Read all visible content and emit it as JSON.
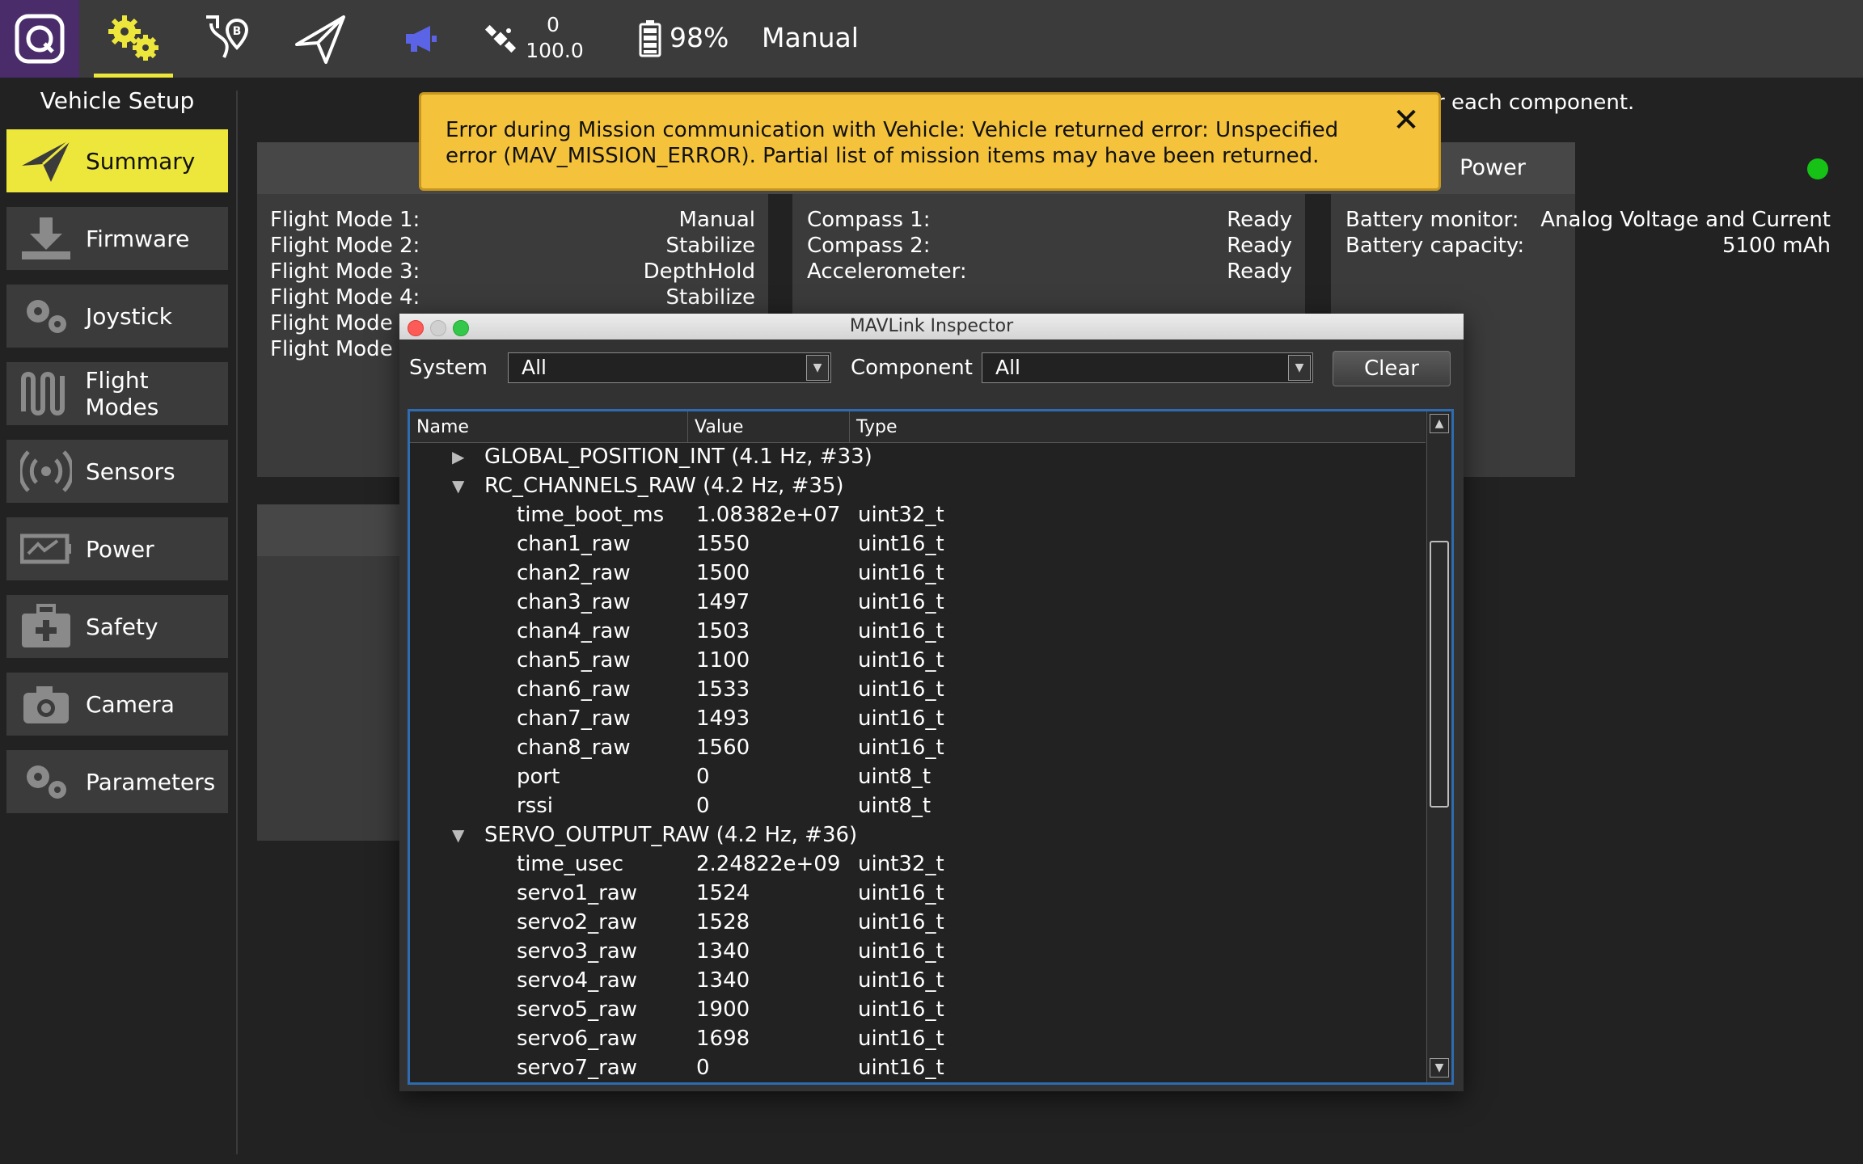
{
  "toolbar": {
    "satellite_count": "0",
    "satellite_hdop": "100.0",
    "battery_percent": "98%",
    "flight_mode": "Manual"
  },
  "sidebar": {
    "title": "Vehicle Setup",
    "items": [
      {
        "label": "Summary",
        "icon": "paper-plane-icon",
        "active": true
      },
      {
        "label": "Firmware",
        "icon": "download-icon"
      },
      {
        "label": "Joystick",
        "icon": "gears-icon"
      },
      {
        "label": "Flight Modes",
        "icon": "wave-icon"
      },
      {
        "label": "Sensors",
        "icon": "radio-waves-icon"
      },
      {
        "label": "Power",
        "icon": "battery-chart-icon"
      },
      {
        "label": "Safety",
        "icon": "first-aid-icon"
      },
      {
        "label": "Camera",
        "icon": "camera-icon"
      },
      {
        "label": "Parameters",
        "icon": "gears-icon"
      }
    ]
  },
  "main": {
    "intro_text": "r each component.",
    "flight_modes": {
      "rows": [
        {
          "label": "Flight Mode 1:",
          "value": "Manual"
        },
        {
          "label": "Flight Mode 2:",
          "value": "Stabilize"
        },
        {
          "label": "Flight Mode 3:",
          "value": "DepthHold"
        },
        {
          "label": "Flight Mode 4:",
          "value": "Stabilize"
        },
        {
          "label": "Flight Mode ",
          "value": ""
        },
        {
          "label": "Flight Mode ",
          "value": ""
        }
      ]
    },
    "sensors": {
      "rows": [
        {
          "label": "Compass 1:",
          "value": "Ready"
        },
        {
          "label": "Compass 2:",
          "value": "Ready"
        },
        {
          "label": "Accelerometer:",
          "value": "Ready"
        }
      ]
    },
    "power": {
      "title": "Power",
      "status_color": "#16c216",
      "rows": [
        {
          "label": "Battery monitor:",
          "value": "Analog Voltage and Current"
        },
        {
          "label": "Battery capacity:",
          "value": "5100 mAh"
        }
      ]
    }
  },
  "error_banner": {
    "message": "Error during Mission communication with Vehicle: Vehicle returned error: Unspecified error (MAV_MISSION_ERROR). Partial list of mission items may have been returned."
  },
  "inspector": {
    "title": "MAVLink Inspector",
    "system_label": "System",
    "system_value": "All",
    "component_label": "Component",
    "component_value": "All",
    "clear_label": "Clear",
    "columns": [
      "Name",
      "Value",
      "Type"
    ],
    "rows": [
      {
        "kind": "group",
        "expanded": false,
        "name": "GLOBAL_POSITION_INT (4.1 Hz, #33)"
      },
      {
        "kind": "group",
        "expanded": true,
        "name": "RC_CHANNELS_RAW (4.2 Hz, #35)"
      },
      {
        "kind": "field",
        "name": "time_boot_ms",
        "value": "1.08382e+07",
        "type": "uint32_t"
      },
      {
        "kind": "field",
        "name": "chan1_raw",
        "value": "1550",
        "type": "uint16_t"
      },
      {
        "kind": "field",
        "name": "chan2_raw",
        "value": "1500",
        "type": "uint16_t"
      },
      {
        "kind": "field",
        "name": "chan3_raw",
        "value": "1497",
        "type": "uint16_t"
      },
      {
        "kind": "field",
        "name": "chan4_raw",
        "value": "1503",
        "type": "uint16_t"
      },
      {
        "kind": "field",
        "name": "chan5_raw",
        "value": "1100",
        "type": "uint16_t"
      },
      {
        "kind": "field",
        "name": "chan6_raw",
        "value": "1533",
        "type": "uint16_t"
      },
      {
        "kind": "field",
        "name": "chan7_raw",
        "value": "1493",
        "type": "uint16_t"
      },
      {
        "kind": "field",
        "name": "chan8_raw",
        "value": "1560",
        "type": "uint16_t"
      },
      {
        "kind": "field",
        "name": "port",
        "value": "0",
        "type": "uint8_t"
      },
      {
        "kind": "field",
        "name": "rssi",
        "value": "0",
        "type": "uint8_t"
      },
      {
        "kind": "group",
        "expanded": true,
        "name": "SERVO_OUTPUT_RAW (4.2 Hz, #36)"
      },
      {
        "kind": "field",
        "name": "time_usec",
        "value": "2.24822e+09",
        "type": "uint32_t"
      },
      {
        "kind": "field",
        "name": "servo1_raw",
        "value": "1524",
        "type": "uint16_t"
      },
      {
        "kind": "field",
        "name": "servo2_raw",
        "value": "1528",
        "type": "uint16_t"
      },
      {
        "kind": "field",
        "name": "servo3_raw",
        "value": "1340",
        "type": "uint16_t"
      },
      {
        "kind": "field",
        "name": "servo4_raw",
        "value": "1340",
        "type": "uint16_t"
      },
      {
        "kind": "field",
        "name": "servo5_raw",
        "value": "1900",
        "type": "uint16_t"
      },
      {
        "kind": "field",
        "name": "servo6_raw",
        "value": "1698",
        "type": "uint16_t"
      },
      {
        "kind": "field",
        "name": "servo7_raw",
        "value": "0",
        "type": "uint16_t"
      }
    ]
  }
}
